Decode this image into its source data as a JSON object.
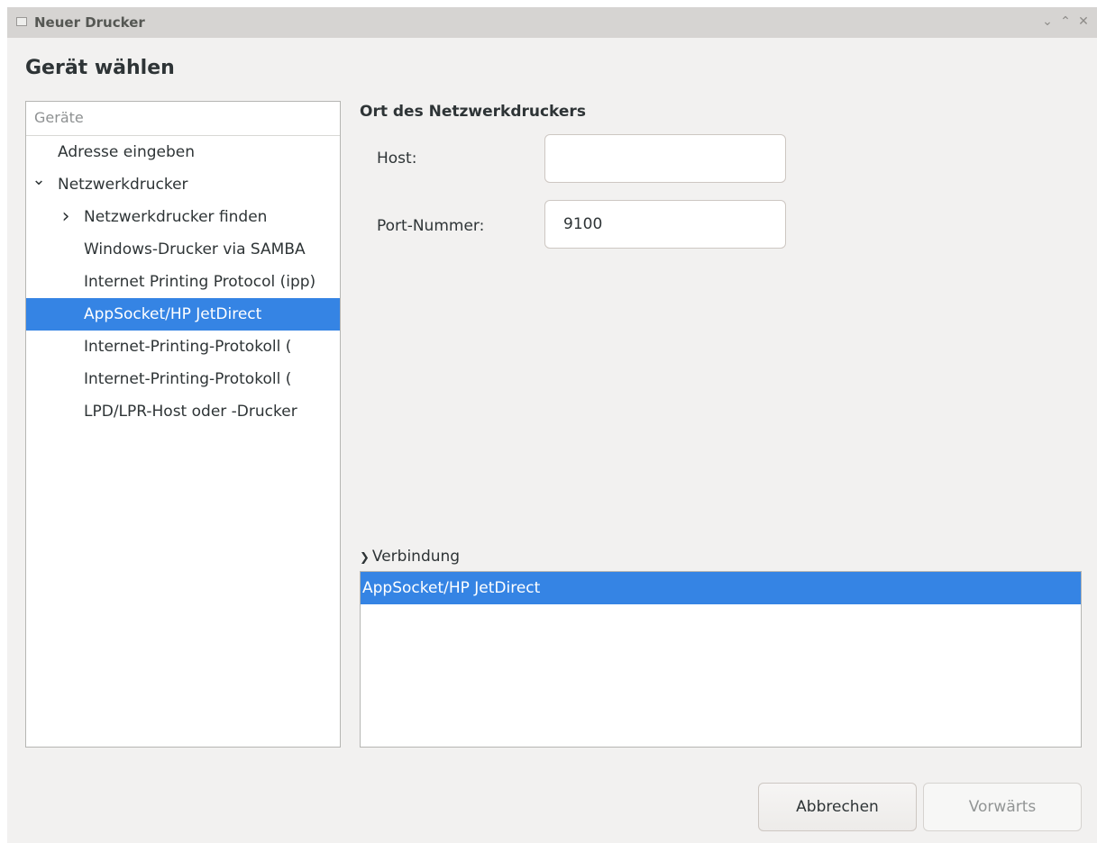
{
  "window": {
    "title": "Neuer Drucker"
  },
  "heading": "Gerät wählen",
  "device_list": {
    "header": "Geräte",
    "items": [
      {
        "label": "Adresse eingeben",
        "level": 0,
        "expander": ""
      },
      {
        "label": "Netzwerkdrucker",
        "level": 0,
        "expander": "chevron-down"
      },
      {
        "label": "Netzwerkdrucker finden",
        "level": 1,
        "expander": "chevron-right"
      },
      {
        "label": "Windows-Drucker via SAMBA",
        "level": 1,
        "expander": ""
      },
      {
        "label": "Internet Printing Protocol (ipp)",
        "level": 1,
        "expander": ""
      },
      {
        "label": "AppSocket/HP JetDirect",
        "level": 1,
        "expander": "",
        "selected": true
      },
      {
        "label": "Internet-Printing-Protokoll (",
        "level": 1,
        "expander": ""
      },
      {
        "label": "Internet-Printing-Protokoll (",
        "level": 1,
        "expander": ""
      },
      {
        "label": "LPD/LPR-Host oder -Drucker",
        "level": 1,
        "expander": ""
      }
    ]
  },
  "network_printer": {
    "section_title": "Ort des Netzwerkdruckers",
    "host_label": "Host:",
    "host_value": "",
    "port_label": "Port-Nummer:",
    "port_value": "9100"
  },
  "connection": {
    "toggle_label": "Verbindung",
    "items": [
      "AppSocket/HP JetDirect"
    ]
  },
  "buttons": {
    "cancel": "Abbrechen",
    "forward": "Vorwärts"
  },
  "colors": {
    "selection": "#3584e4",
    "window_bg": "#f2f1f0",
    "titlebar_bg": "#d6d4d2"
  }
}
